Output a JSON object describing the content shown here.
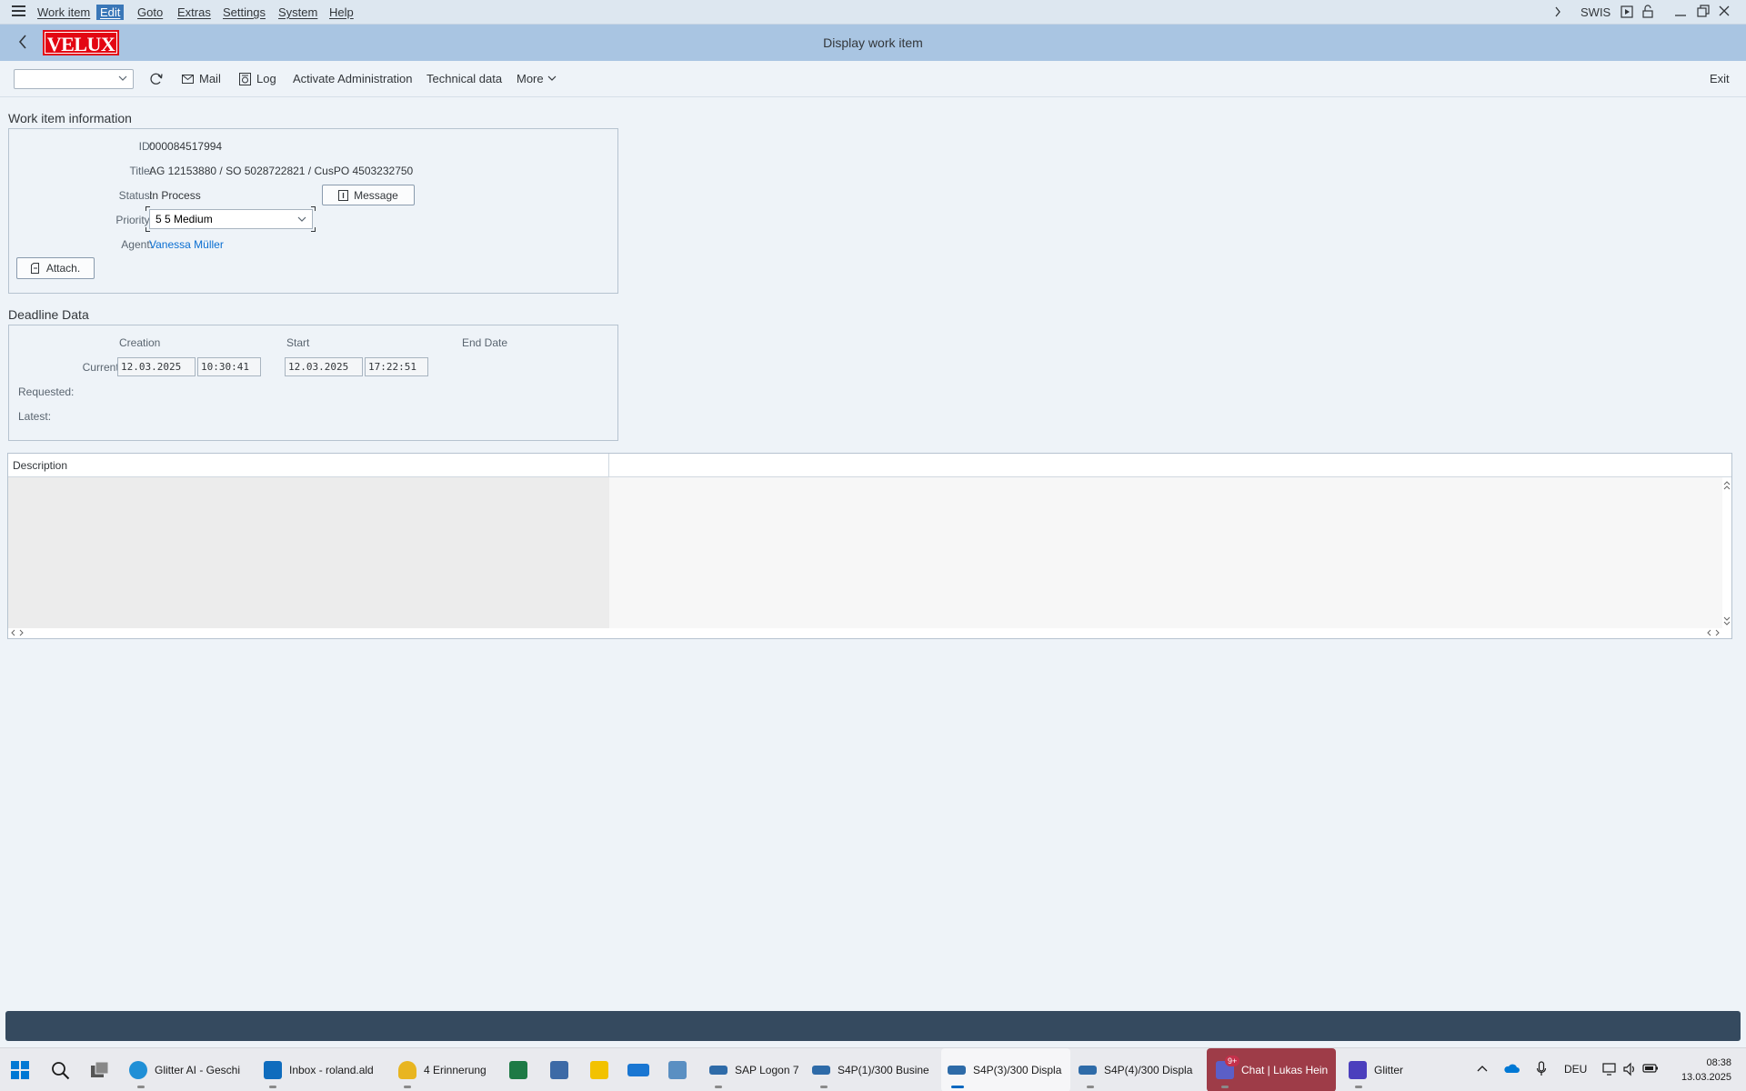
{
  "menu": {
    "items": [
      "Work item",
      "Edit",
      "Goto",
      "Extras",
      "Settings",
      "System",
      "Help"
    ],
    "active": "Edit",
    "system_id": "SWIS"
  },
  "header": {
    "logo_text": "VELUX",
    "title": "Display work item"
  },
  "toolbar": {
    "select_value": "",
    "mail_label": "Mail",
    "log_label": "Log",
    "activate_admin_label": "Activate Administration",
    "technical_data_label": "Technical data",
    "more_label": "More",
    "exit_label": "Exit"
  },
  "work_item": {
    "group_title": "Work item information",
    "id_label": "ID:",
    "id_value": "000084517994",
    "title_label": "Title:",
    "title_value": "AG 12153880 / SO 5028722821 / CusPO 4503232750",
    "status_label": "Status:",
    "status_value": "In Process",
    "message_button": "Message",
    "priority_label": "Priority:",
    "priority_value": "5 5 Medium",
    "agent_label": "Agent:",
    "agent_value": "Vanessa Müller",
    "attach_button": "Attach."
  },
  "deadline": {
    "group_title": "Deadline Data",
    "col_creation": "Creation",
    "col_start": "Start",
    "col_end": "End Date",
    "current_label": "Current:",
    "requested_label": "Requested:",
    "latest_label": "Latest:",
    "creation_date": "12.03.2025",
    "creation_time": "10:30:41",
    "start_date": "12.03.2025",
    "start_time": "17:22:51"
  },
  "description": {
    "header": "Description"
  },
  "taskbar": {
    "items": [
      {
        "label": "Glitter AI - Geschi",
        "color": "#1f8fd6"
      },
      {
        "label": "Inbox - roland.ald",
        "color": "#0f6cbd"
      },
      {
        "label": "4 Erinnerung",
        "color": "#e8b520"
      },
      {
        "label": "",
        "color": "#1d7a45"
      },
      {
        "label": "",
        "color": "#3d6aa6"
      },
      {
        "label": "",
        "color": "#f2c200"
      },
      {
        "label": "",
        "color": "#1976d2"
      },
      {
        "label": "",
        "color": "#5a8fc2"
      },
      {
        "label": "SAP Logon 7",
        "color": "#2e6ba8"
      },
      {
        "label": "S4P(1)/300 Busine",
        "color": "#2e6ba8"
      },
      {
        "label": "S4P(3)/300 Displa",
        "color": "#2e6ba8"
      },
      {
        "label": "S4P(4)/300 Displa",
        "color": "#2e6ba8"
      },
      {
        "label": "Chat | Lukas Hein",
        "color": "#5b5fc7"
      },
      {
        "label": "Glitter",
        "color": "#4b3fbd"
      }
    ],
    "teams_badge": "9+",
    "language": "DEU",
    "time": "08:38",
    "date": "13.03.2025"
  }
}
